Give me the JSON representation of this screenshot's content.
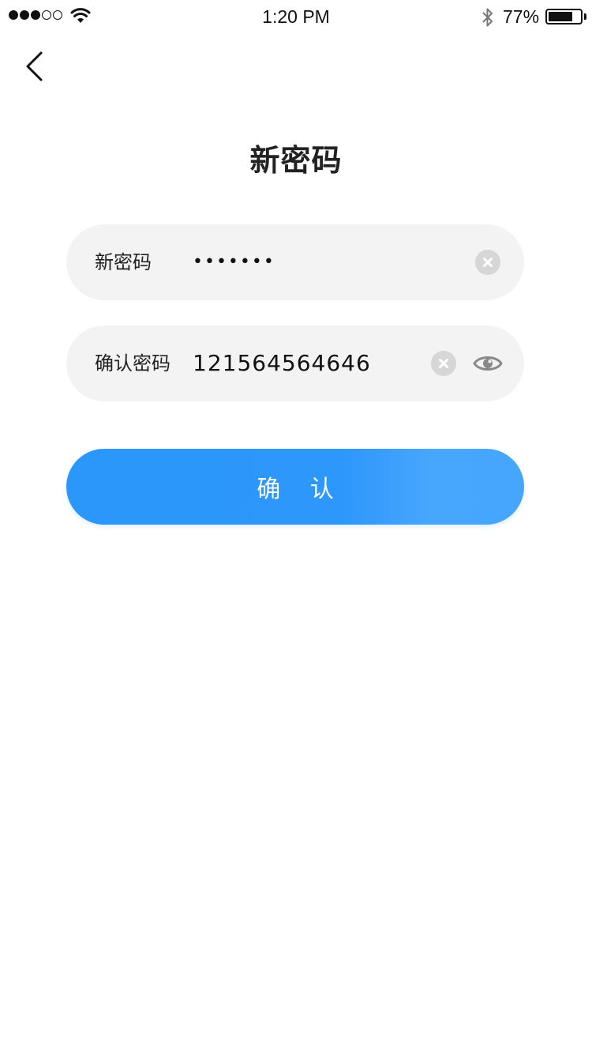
{
  "status_bar": {
    "time": "1:20 PM",
    "battery_percent": "77%",
    "battery_level": 0.77,
    "signal_bars_filled": 3,
    "signal_bars_total": 5
  },
  "header": {
    "title": "新密码",
    "back_icon": "chevron-left-icon"
  },
  "form": {
    "new_password": {
      "label": "新密码",
      "value": "•••••••",
      "clear_icon": "clear-icon"
    },
    "confirm_password": {
      "label": "确认密码",
      "value": "121564564646",
      "clear_icon": "clear-icon",
      "visibility_icon": "eye-icon"
    },
    "submit_label": "确 认"
  },
  "colors": {
    "accent": "#2c97fb",
    "field_bg": "#f3f3f3"
  }
}
